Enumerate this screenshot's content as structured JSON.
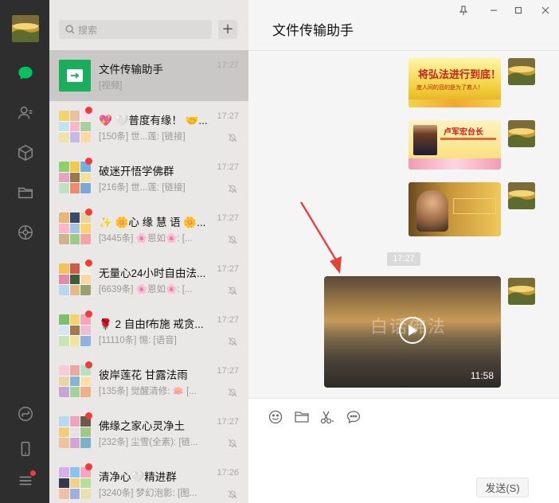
{
  "rail": {
    "icons": [
      "chat-icon",
      "contacts-icon",
      "favorites-icon",
      "files-icon",
      "moments-icon",
      "mini-program-icon",
      "phone-icon",
      "menu-icon"
    ]
  },
  "search": {
    "placeholder": "搜索",
    "add_label": "+"
  },
  "chats": [
    {
      "name": "文件传输助手",
      "preview": "[视频]",
      "time": "17:27",
      "selected": true,
      "unread_dot": false,
      "muted": false
    },
    {
      "name": "💖 🤍普度有缘！ 🤝...",
      "preview": "[150条] 世...莲: [链接]",
      "time": "17:27",
      "selected": false,
      "unread_dot": true,
      "muted": true
    },
    {
      "name": "破迷开悟学佛群",
      "preview": "[216条] 世...莲: [链接]",
      "time": "17:27",
      "selected": false,
      "unread_dot": true,
      "muted": true
    },
    {
      "name": "✨ 🌼心 缘 慧 语 🌼...",
      "preview": "[3445条] 🌸恩如🌸: [...",
      "time": "17:27",
      "selected": false,
      "unread_dot": true,
      "muted": true
    },
    {
      "name": "无量心24小时自由法...",
      "preview": "[6639条] 🌸恩如🌸: [...",
      "time": "17:27",
      "selected": false,
      "unread_dot": true,
      "muted": true
    },
    {
      "name": "🌹 2 自由f布施 戒贪...",
      "preview": "[11110条] 惕: [语音]",
      "time": "17:27",
      "selected": false,
      "unread_dot": true,
      "muted": true
    },
    {
      "name": "彼岸莲花 甘露法雨",
      "preview": "[135条] 觉醒清修: 🪷 [...",
      "time": "17:27",
      "selected": false,
      "unread_dot": true,
      "muted": true
    },
    {
      "name": "佛缘之家心灵净土",
      "preview": "[232条] 尘雪(全素): [链...",
      "time": "17:27",
      "selected": false,
      "unread_dot": true,
      "muted": true
    },
    {
      "name": "清净心🤍精进群",
      "preview": "[3240条] 梦幻泡影: [图...",
      "time": "17:26",
      "selected": false,
      "unread_dot": true,
      "muted": true
    }
  ],
  "window_controls": [
    "pin-icon",
    "minimize-icon",
    "maximize-icon",
    "close-icon"
  ],
  "conversation": {
    "title": "文件传输助手",
    "messages": [
      {
        "kind": "image",
        "caption_line1": "将弘法进行到底！",
        "caption_line2": "度人间的目的是为了救人！"
      },
      {
        "kind": "image",
        "caption_line1": "卢军宏台长"
      },
      {
        "kind": "image",
        "caption_line1": ""
      },
      {
        "kind": "time",
        "text": "17:27"
      },
      {
        "kind": "video",
        "duration": "11:58",
        "overlay_text": "白话佛法"
      }
    ]
  },
  "composer": {
    "tools": [
      "emoji-icon",
      "folder-icon",
      "scissors-icon",
      "chat-bubble-icon"
    ],
    "send_label": "发送(S)"
  },
  "colors": {
    "rail": "#2e2e2e",
    "list": "#e9e8e7",
    "selected": "#c9c8c7",
    "chat_bg": "#f5f5f5",
    "accent": "#07c160",
    "badge": "#f43b3b"
  }
}
